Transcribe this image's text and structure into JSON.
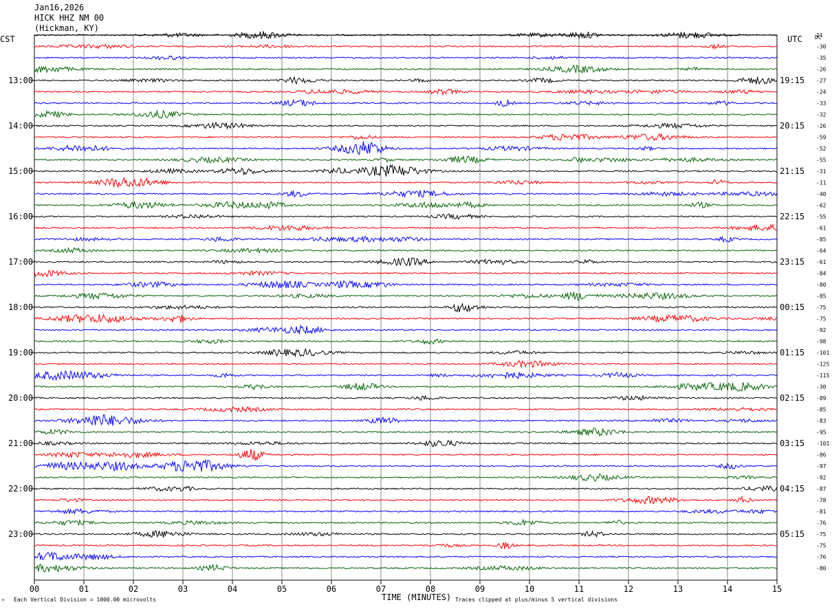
{
  "header": {
    "date": "Jan16,2026",
    "station": "HICK HHZ NM 00",
    "location": "(Hickman, KY)"
  },
  "labels": {
    "left_timezone": "CST",
    "right_timezone": "UTC",
    "dc_label": "DC",
    "footer_left": "Each Vertical Division = 1000.00 microvolts",
    "footer_right": "Traces clipped at plus/minus 5 vertical divisions",
    "corner_mark": "ᴹ"
  },
  "colors": [
    "#000000",
    "#ff0000",
    "#0000ff",
    "#006400"
  ],
  "chart_data": {
    "type": "line",
    "title": "",
    "xlabel": "TIME (MINUTES)",
    "ylabel": "",
    "x_ticks": [
      "00",
      "01",
      "02",
      "03",
      "04",
      "05",
      "06",
      "07",
      "08",
      "09",
      "10",
      "11",
      "12",
      "13",
      "14",
      "15"
    ],
    "xlim": [
      0,
      15
    ],
    "grid": true,
    "rows_per_hour": 4,
    "left_hour_labels": [
      "13:00",
      "14:00",
      "15:00",
      "16:00",
      "17:00",
      "18:00",
      "19:00",
      "20:00",
      "21:00",
      "22:00",
      "23:00"
    ],
    "right_hour_labels": [
      "19:15",
      "20:15",
      "21:15",
      "22:15",
      "23:15",
      "00:15",
      "01:15",
      "02:15",
      "03:15",
      "04:15",
      "05:15"
    ],
    "first_hour_label_row": 4,
    "dc_offsets": [
      "21",
      "-30",
      "-35",
      "-26",
      "-27",
      "-24",
      "-33",
      "-32",
      "-26",
      "-59",
      "-52",
      "-55",
      "-31",
      "-11",
      "-40",
      "-62",
      "-55",
      "-61",
      "-85",
      "-64",
      "-61",
      "-84",
      "-80",
      "-85",
      "-75",
      "-75",
      "-92",
      "-98",
      "-101",
      "-125",
      "-115",
      "-30",
      "-89",
      "-85",
      "-83",
      "-95",
      "-101",
      "-86",
      "-97",
      "-92",
      "-87",
      "-78",
      "-81",
      "-76",
      "-75",
      "-75",
      "-76",
      "-80"
    ]
  }
}
